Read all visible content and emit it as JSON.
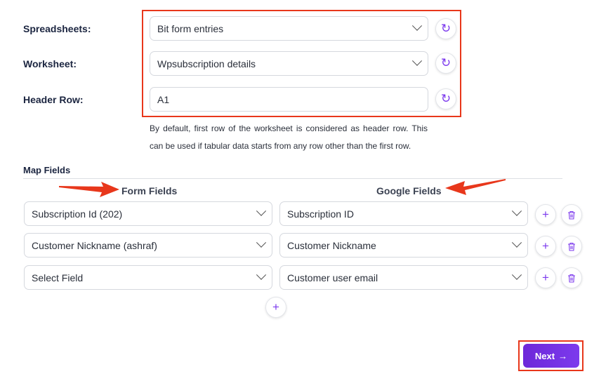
{
  "config": {
    "spreadsheets_label": "Spreadsheets:",
    "spreadsheets_value": "Bit form entries",
    "worksheet_label": "Worksheet:",
    "worksheet_value": "Wpsubscription details",
    "header_row_label": "Header Row:",
    "header_row_value": "A1",
    "header_row_note": "By default, first row of the worksheet is considered as header row. This can be used if tabular data starts from any row other than the first row."
  },
  "map_fields": {
    "title": "Map Fields",
    "form_fields_header": "Form Fields",
    "google_fields_header": "Google Fields",
    "rows": [
      {
        "form_field": "Subscription Id (202)",
        "google_field": "Subscription ID"
      },
      {
        "form_field": "Customer Nickname (ashraf)",
        "google_field": "Customer Nickname"
      },
      {
        "form_field": "Select Field",
        "google_field": "Customer user email"
      }
    ]
  },
  "icons": {
    "refresh": "↻",
    "add": "+",
    "next_arrow": "→"
  },
  "buttons": {
    "next_label": "Next"
  },
  "colors": {
    "accent": "#7c3aed",
    "highlight": "#e8371b",
    "label": "#1b2540"
  }
}
